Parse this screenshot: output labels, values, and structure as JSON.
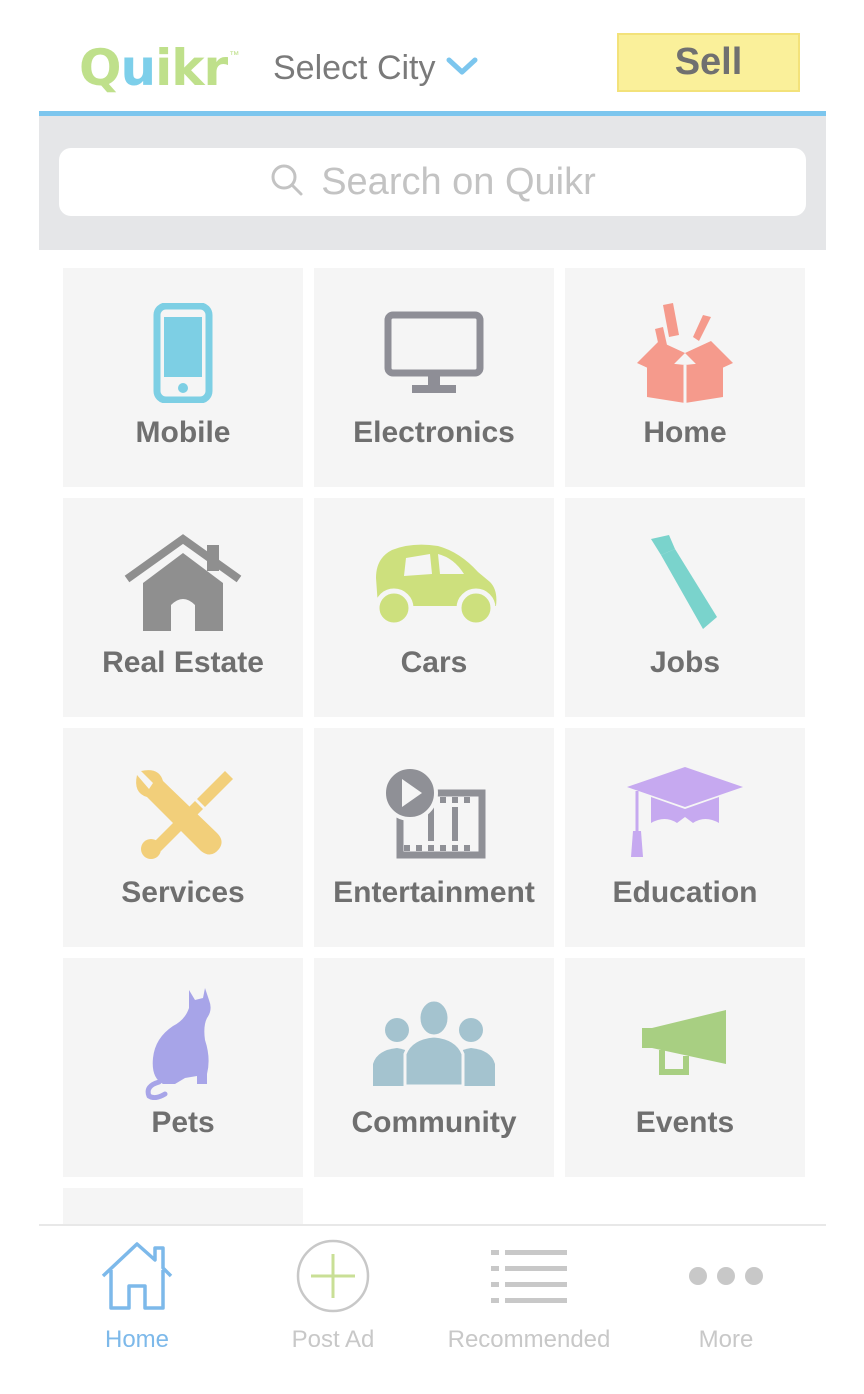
{
  "header": {
    "logo_text": "Quikr",
    "logo_tm": "™",
    "city_label": "Select City",
    "sell_label": "Sell",
    "accent_color": "#7cc6ee"
  },
  "search": {
    "placeholder": "Search on Quikr",
    "icon": "search-icon"
  },
  "categories": [
    {
      "label": "Mobile",
      "icon": "mobile-phone-icon",
      "color": "#7dcfe4"
    },
    {
      "label": "Electronics",
      "icon": "monitor-icon",
      "color": "#8e8e96"
    },
    {
      "label": "Home",
      "icon": "box-icon",
      "color": "#f59a8c"
    },
    {
      "label": "Real Estate",
      "icon": "house-icon",
      "color": "#8f8f8f"
    },
    {
      "label": "Cars",
      "icon": "car-icon",
      "color": "#cde07d"
    },
    {
      "label": "Jobs",
      "icon": "tie-icon",
      "color": "#7ad3cc"
    },
    {
      "label": "Services",
      "icon": "tools-icon",
      "color": "#f2cf7a"
    },
    {
      "label": "Entertainment",
      "icon": "video-film-icon",
      "color": "#8f9096"
    },
    {
      "label": "Education",
      "icon": "graduation-cap-icon",
      "color": "#c6a9f0"
    },
    {
      "label": "Pets",
      "icon": "cat-icon",
      "color": "#a7a4e8"
    },
    {
      "label": "Community",
      "icon": "people-icon",
      "color": "#a4c3cf"
    },
    {
      "label": "Events",
      "icon": "megaphone-icon",
      "color": "#a8cf82"
    }
  ],
  "bottom_nav": [
    {
      "label": "Home",
      "icon": "home-icon",
      "active": true
    },
    {
      "label": "Post Ad",
      "icon": "plus-circle-icon",
      "active": false
    },
    {
      "label": "Recommended",
      "icon": "list-icon",
      "active": false
    },
    {
      "label": "More",
      "icon": "more-dots-icon",
      "active": false
    }
  ]
}
